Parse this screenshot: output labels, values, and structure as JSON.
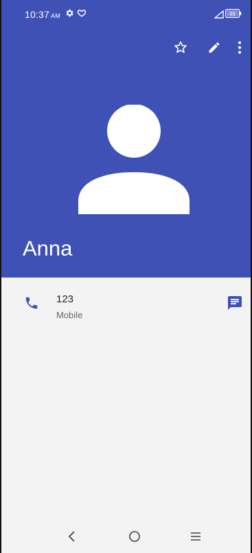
{
  "status_bar": {
    "time": "10:37",
    "ampm": "AM",
    "battery": "89"
  },
  "contact": {
    "name": "Anna"
  },
  "phone_entry": {
    "number": "123",
    "type": "Mobile"
  },
  "icons": {
    "settings": "gear-icon",
    "heart": "heart-icon",
    "signal": "signal-icon",
    "battery": "battery-icon",
    "favorite": "star-outline-icon",
    "edit": "pencil-icon",
    "more": "more-vert-icon",
    "avatar": "person-placeholder",
    "call": "phone-icon",
    "message": "message-icon",
    "back": "back-icon",
    "home": "home-icon",
    "recents": "menu-icon"
  },
  "colors": {
    "header": "#3f51b5",
    "accent": "#3f51b5",
    "background": "#f3f3f3"
  }
}
